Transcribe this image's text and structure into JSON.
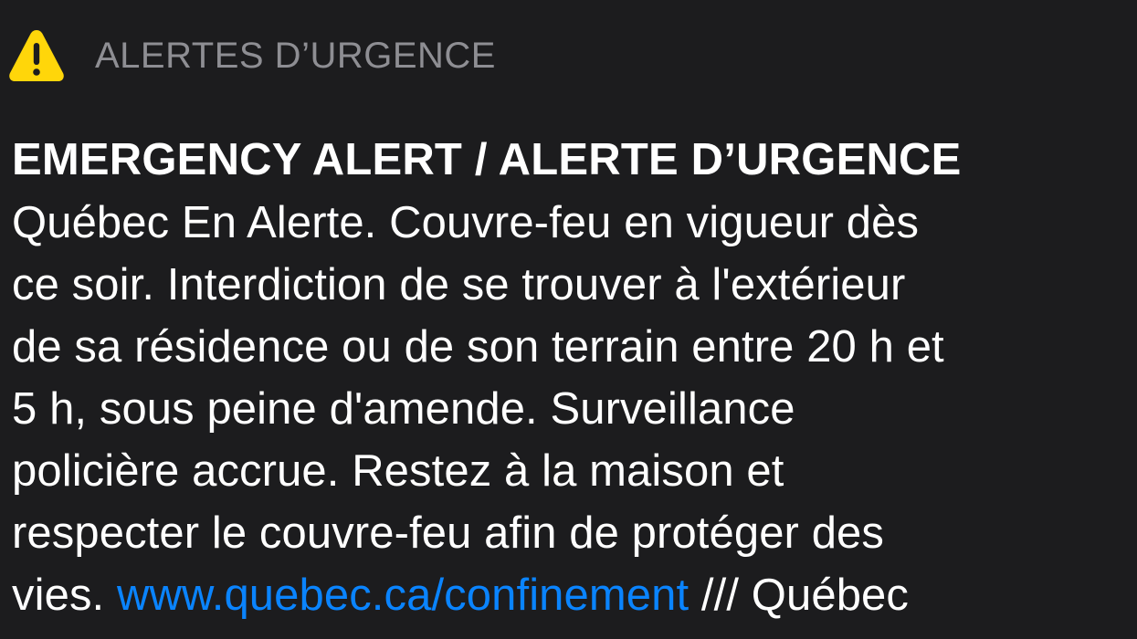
{
  "header": {
    "icon": "warning-triangle-icon",
    "icon_color": "#ffd60a",
    "app_name": "ALERTES D’URGENCE"
  },
  "alert": {
    "title": "EMERGENCY ALERT / ALERTE D’URGENCE",
    "body_lines": [
      "Québec En Alerte. Couvre-feu en vigueur dès",
      "ce soir. Interdiction de se trouver à l'extérieur",
      "de sa résidence ou de son terrain entre 20 h et",
      "5 h, sous peine d'amende. Surveillance",
      "policière accrue. Restez à la maison et",
      "respecter le couvre-feu afin de protéger des"
    ],
    "last_line": {
      "prefix": "vies. ",
      "link_text": "www.quebec.ca/confinement",
      "suffix": " /// Québec"
    }
  },
  "colors": {
    "background": "#1c1c1e",
    "text": "#ffffff",
    "secondary_text": "#8e8e93",
    "link": "#0a84ff",
    "warning": "#ffd60a"
  }
}
